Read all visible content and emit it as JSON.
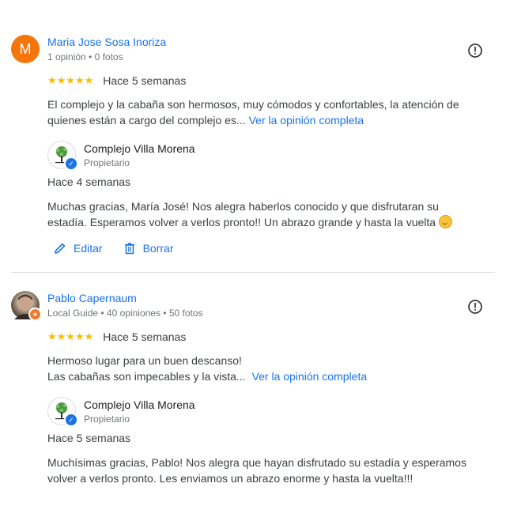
{
  "reviews": [
    {
      "author": "Maria Jose Sosa Inoriza",
      "avatar_letter": "M",
      "meta": "1 opinión • 0 fotos",
      "stars": "★★★★★",
      "date": "Hace 5 semanas",
      "text": "El complejo y la cabaña son hermosos, muy cómodos y confortables, la atención de quienes están a cargo del complejo es...",
      "more_label": "Ver la opinión completa",
      "owner": {
        "name": "Complejo Villa Morena",
        "role": "Propietario",
        "date": "Hace 4 semanas",
        "reply": "Muchas gracias, María José! Nos alegra haberlos conocido y que disfrutaran su estadía. Esperamos volver a verlos pronto!! Un abrazo grande y hasta la vuelta"
      },
      "actions": {
        "edit_label": "Editar",
        "delete_label": "Borrar"
      }
    },
    {
      "author": "Pablo Capernaum",
      "meta": "Local Guide • 40 opiniones • 50 fotos",
      "stars": "★★★★★",
      "date": "Hace 5 semanas",
      "text_line1": "Hermoso lugar para un buen descanso!",
      "text_line2": "Las cabañas son impecables y la vista...",
      "more_label": "Ver la opinión completa",
      "owner": {
        "name": "Complejo Villa Morena",
        "role": "Propietario",
        "date": "Hace 5 semanas",
        "reply": "Muchísimas gracias, Pablo! Nos alegra que hayan disfrutado su estadía y esperamos volver a verlos pronto. Les enviamos un abrazo enorme y hasta la vuelta!!!"
      }
    }
  ],
  "colors": {
    "link": "#1a73e8",
    "star": "#fbbc04",
    "avatar": "#f4750a"
  }
}
